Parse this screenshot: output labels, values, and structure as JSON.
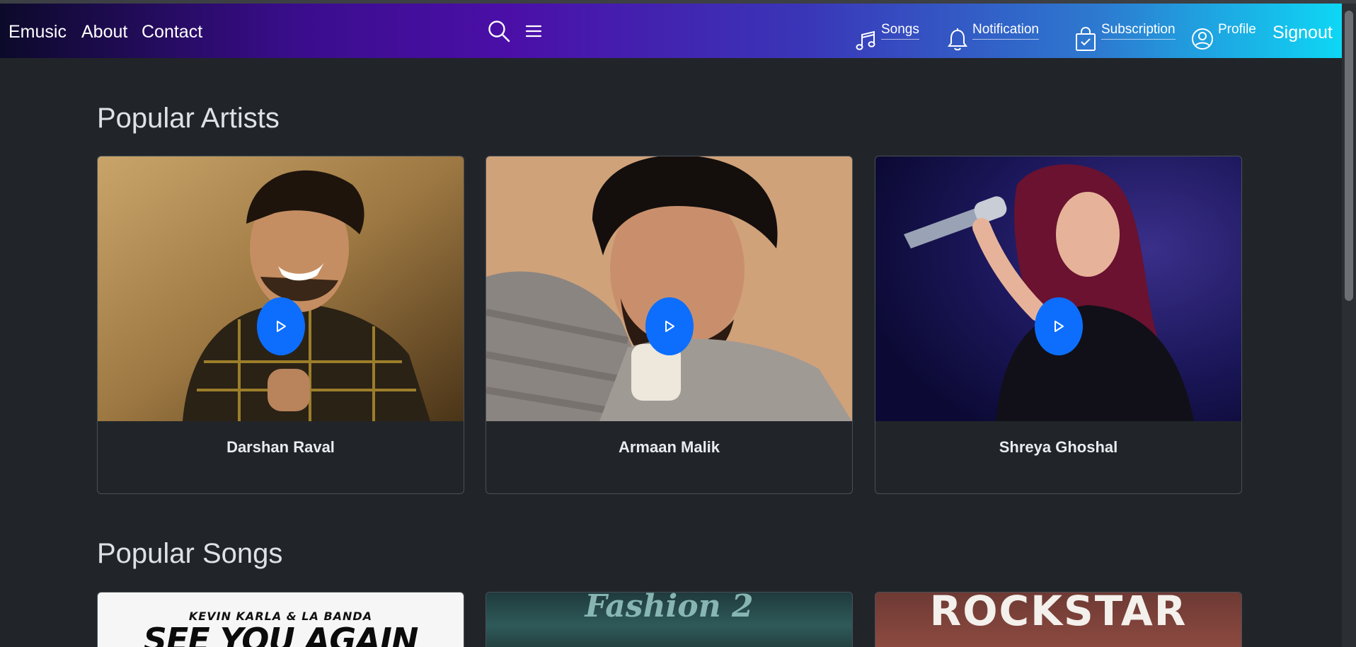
{
  "nav": {
    "brand": "Emusic",
    "about": "About",
    "contact": "Contact",
    "songs": "Songs",
    "notification": "Notification",
    "subscription": "Subscription",
    "profile": "Profile",
    "signout": "Signout"
  },
  "artists": {
    "title": "Popular Artists",
    "items": [
      {
        "name": "Darshan Raval"
      },
      {
        "name": "Armaan Malik"
      },
      {
        "name": "Shreya Ghoshal"
      }
    ]
  },
  "songs": {
    "title": "Popular Songs",
    "items": [
      {
        "artist_line": "KEVIN KARLA & LA BANDA",
        "title": "SEE YOU AGAIN"
      },
      {
        "title": "Fashion 2"
      },
      {
        "title": "ROCKSTAR"
      }
    ]
  },
  "colors": {
    "accent": "#0d6efd",
    "background": "#212529"
  },
  "icons": [
    "search-icon",
    "menu-icon",
    "music-note-icon",
    "bell-icon",
    "bag-check-icon",
    "person-circle-icon",
    "play-icon"
  ]
}
